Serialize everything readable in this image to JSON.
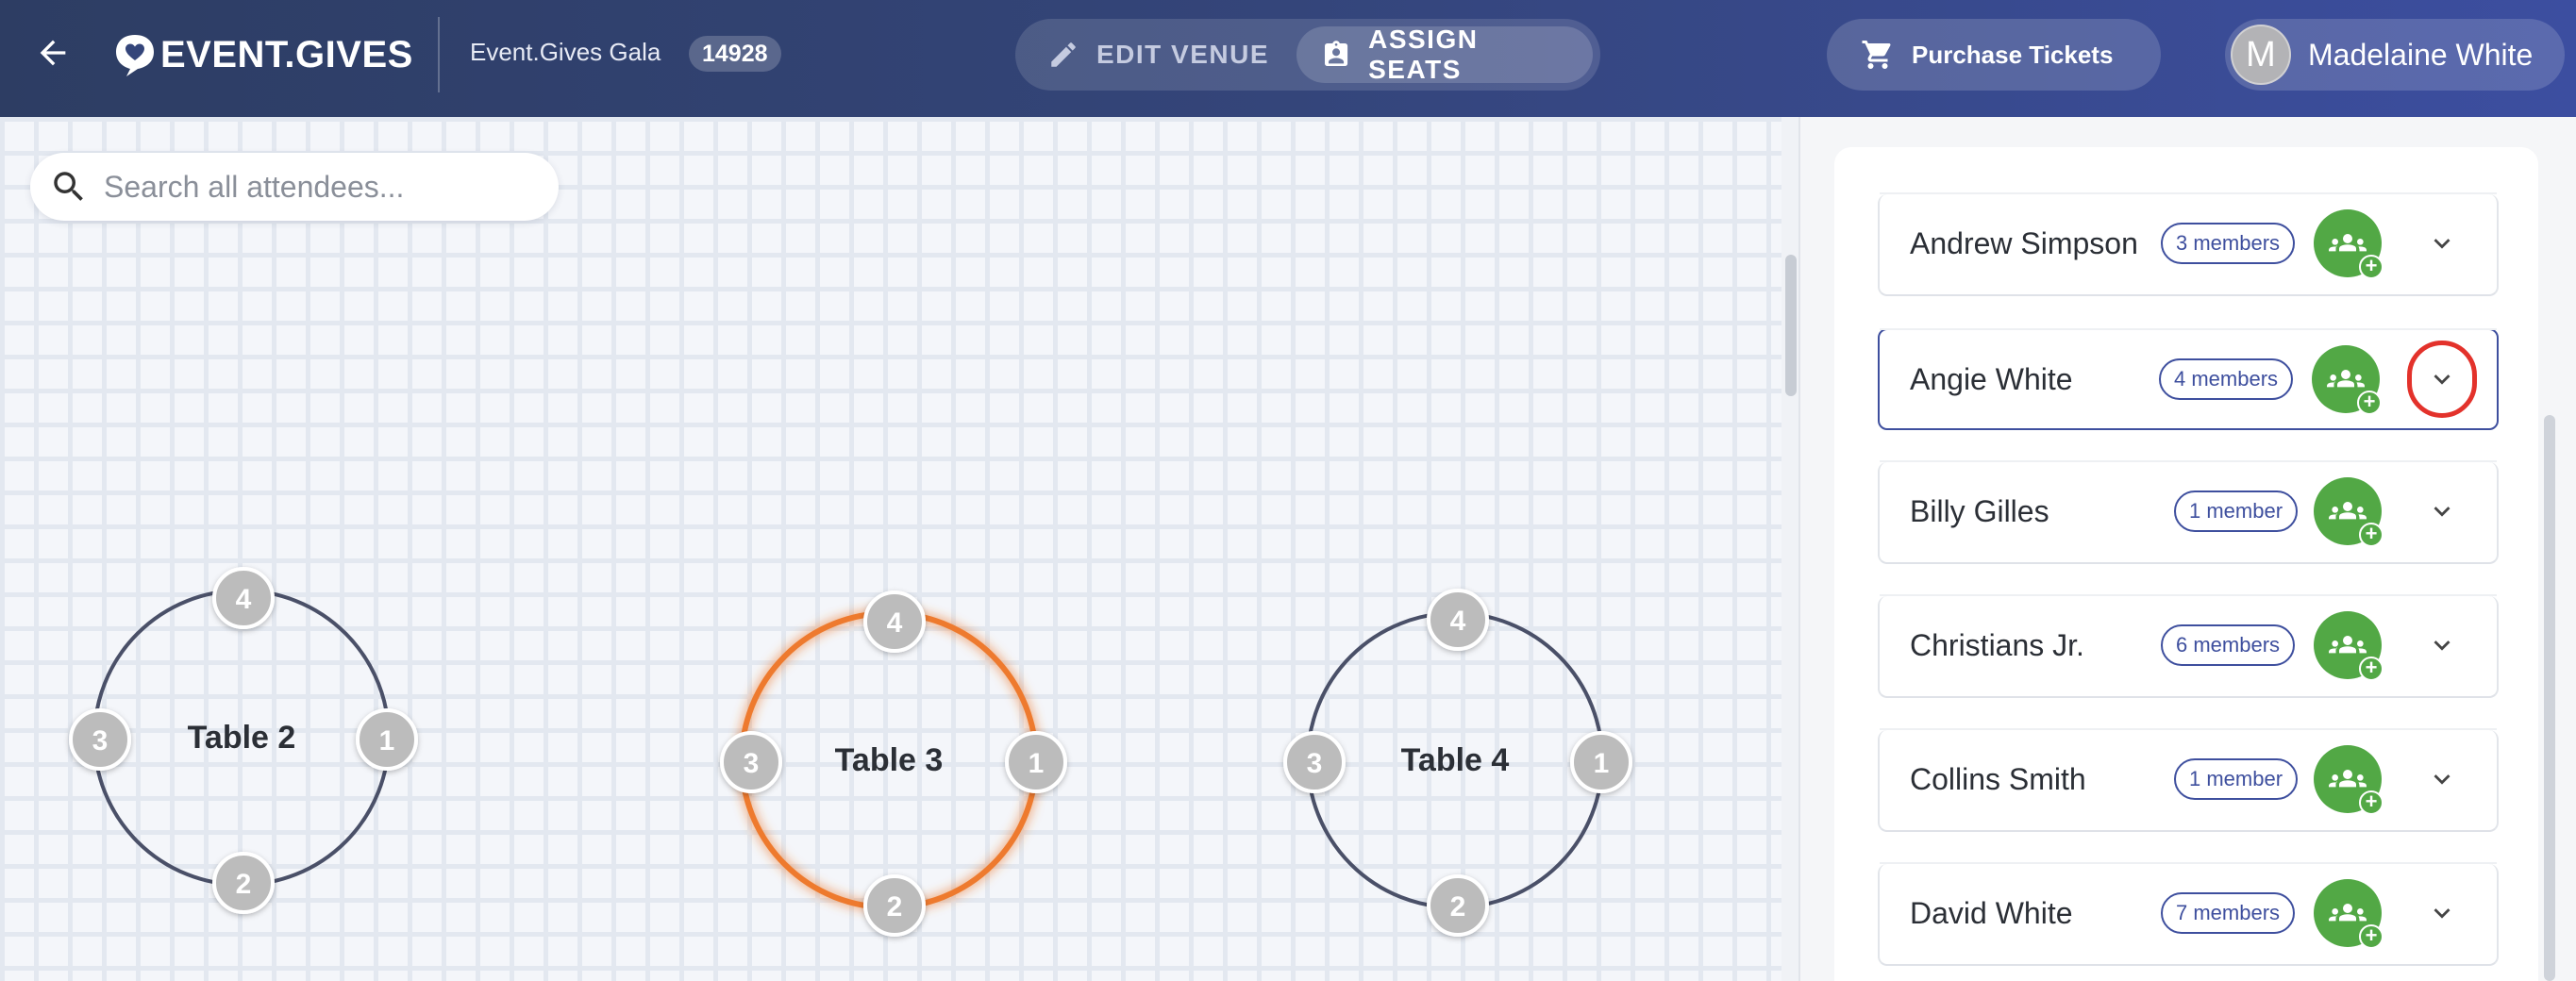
{
  "header": {
    "back_label": "Back",
    "logo_text": "EVENT.GIVES",
    "event_name": "Event.Gives Gala",
    "event_id": "14928",
    "modes": [
      {
        "label": "EDIT VENUE",
        "icon": "pencil-icon",
        "active": false
      },
      {
        "label": "ASSIGN SEATS",
        "icon": "badge-icon",
        "active": true
      }
    ],
    "purchase_label": "Purchase Tickets",
    "user": {
      "initial": "M",
      "name": "Madelaine White"
    }
  },
  "search": {
    "placeholder": "Search all attendees..."
  },
  "tables": [
    {
      "label": "Table 2",
      "seats": [
        "4",
        "1",
        "2",
        "3"
      ],
      "highlighted": false
    },
    {
      "label": "Table 3",
      "seats": [
        "4",
        "1",
        "2",
        "3"
      ],
      "highlighted": true
    },
    {
      "label": "Table 4",
      "seats": [
        "4",
        "1",
        "2",
        "3"
      ],
      "highlighted": false
    }
  ],
  "attendees": [
    {
      "name": "Andrew Simpson",
      "members": "3 members",
      "selected": false
    },
    {
      "name": "Angie White",
      "members": "4 members",
      "selected": true
    },
    {
      "name": "Billy Gilles",
      "members": "1 member",
      "selected": false
    },
    {
      "name": "Christians Jr.",
      "members": "6 members",
      "selected": false
    },
    {
      "name": "Collins Smith",
      "members": "1 member",
      "selected": false
    },
    {
      "name": "David White",
      "members": "7 members",
      "selected": false
    }
  ],
  "colors": {
    "header_start": "#2d3d63",
    "header_end": "#3c4ea0",
    "accent": "#3e4f9e",
    "highlight_table": "#ee7a2f",
    "add_button": "#52a845",
    "annotation_circle": "#e3322b"
  }
}
